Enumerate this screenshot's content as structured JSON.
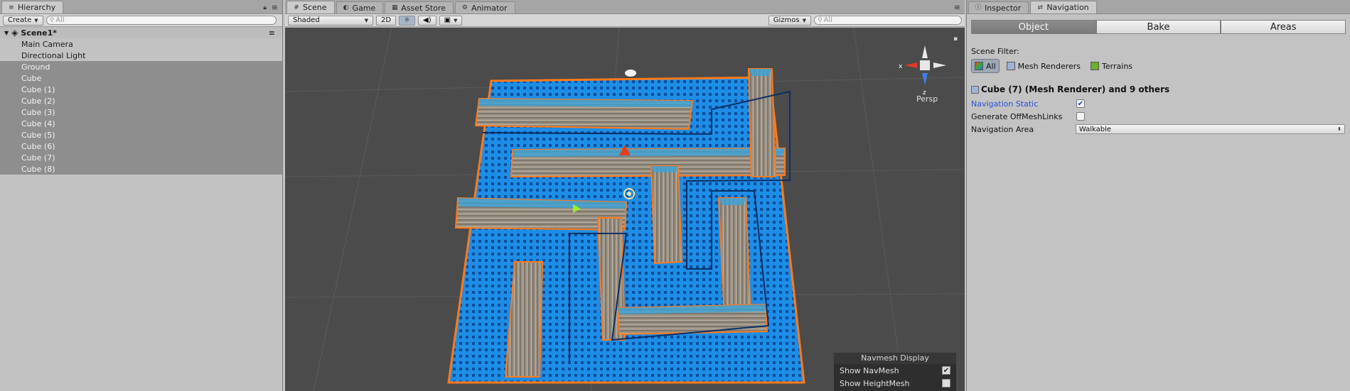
{
  "hierarchy": {
    "tab_label": "Hierarchy",
    "create_label": "Create",
    "search_placeholder": "All",
    "scene_name": "Scene1*",
    "items": [
      {
        "label": "Main Camera",
        "selected": false
      },
      {
        "label": "Directional Light",
        "selected": false
      },
      {
        "label": "Ground",
        "selected": true
      },
      {
        "label": "Cube",
        "selected": true
      },
      {
        "label": "Cube (1)",
        "selected": true
      },
      {
        "label": "Cube (2)",
        "selected": true
      },
      {
        "label": "Cube (3)",
        "selected": true
      },
      {
        "label": "Cube (4)",
        "selected": true
      },
      {
        "label": "Cube (5)",
        "selected": true
      },
      {
        "label": "Cube (6)",
        "selected": true
      },
      {
        "label": "Cube (7)",
        "selected": true
      },
      {
        "label": "Cube (8)",
        "selected": true
      }
    ]
  },
  "scene": {
    "tabs": [
      {
        "label": "Scene",
        "icon": "hash-icon",
        "active": true
      },
      {
        "label": "Game",
        "icon": "gamepad-icon",
        "active": false
      },
      {
        "label": "Asset Store",
        "icon": "store-icon",
        "active": false
      },
      {
        "label": "Animator",
        "icon": "animator-icon",
        "active": false
      }
    ],
    "shading_mode": "Shaded",
    "mode_2d": "2D",
    "gizmos_label": "Gizmos",
    "search_placeholder": "All",
    "gizmo": {
      "x_label": "x",
      "z_label": "z",
      "projection": "Persp"
    },
    "navmesh_display": {
      "title": "Navmesh Display",
      "show_navmesh_label": "Show NavMesh",
      "show_navmesh": true,
      "show_heightmesh_label": "Show HeightMesh",
      "show_heightmesh": false
    }
  },
  "navigation": {
    "tabs": [
      {
        "label": "Inspector",
        "icon": "info-icon",
        "active": false
      },
      {
        "label": "Navigation",
        "icon": "navigation-icon",
        "active": true
      }
    ],
    "sections": [
      {
        "label": "Object",
        "active": true
      },
      {
        "label": "Bake",
        "active": false
      },
      {
        "label": "Areas",
        "active": false
      }
    ],
    "scene_filter_label": "Scene Filter:",
    "filters": [
      {
        "label": "All",
        "active": true
      },
      {
        "label": "Mesh Renderers",
        "active": false
      },
      {
        "label": "Terrains",
        "active": false
      }
    ],
    "selection_title": "Cube (7) (Mesh Renderer) and 9 others",
    "navigation_static_label": "Navigation Static",
    "navigation_static": true,
    "generate_offmeshlinks_label": "Generate OffMeshLinks",
    "generate_offmeshlinks": false,
    "navigation_area_label": "Navigation Area",
    "navigation_area_value": "Walkable"
  },
  "colors": {
    "navmesh_blue": "#1e8de6",
    "selection_orange": "#ff7a1a",
    "link_blue": "#2a4fd8",
    "viewport_bg": "#4b4b4b"
  }
}
